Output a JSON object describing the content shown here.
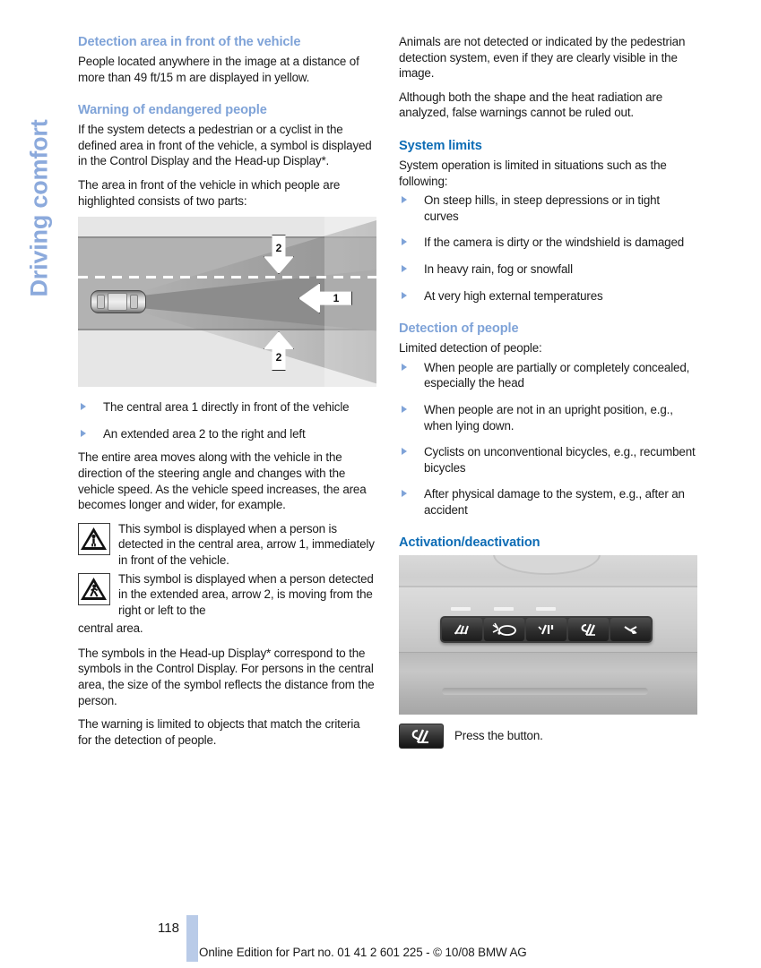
{
  "sidebar": {
    "chapter_label": "Driving comfort"
  },
  "left_column": {
    "heading_detection_area": "Detection area in front of the vehicle",
    "para_detection_area": "People located anywhere in the image at a distance of more than 49 ft/15 m are displayed in yellow.",
    "heading_warning": "Warning of endangered people",
    "para_warning_1": "If the system detects a pedestrian or a cyclist in the defined area in front of the vehicle, a symbol is displayed in the Control Display and the Head-up Display*.",
    "para_warning_2": "The area in front of the vehicle in which people are highlighted consists of two parts:",
    "figure_road": {
      "name": "detection-area-diagram",
      "callout_central": "1",
      "callout_extended_top": "2",
      "callout_extended_bottom": "2"
    },
    "area_bullets": [
      "The central area 1 directly in front of the vehicle",
      "An extended area 2 to the right and left"
    ],
    "para_area_moves": "The entire area moves along with the vehicle in the direction of the steering angle and changes with the vehicle speed. As the vehicle speed increases, the area becomes longer and wider, for example.",
    "symbol_rows": [
      {
        "icon": "pedestrian-warning-central-icon",
        "text": "This symbol is displayed when a person is detected in the central area, arrow 1, immediately in front of the vehicle."
      },
      {
        "icon": "pedestrian-warning-extended-icon",
        "text": "This symbol is displayed when a person detected in the extended area, arrow 2, is moving from the right or left to the"
      }
    ],
    "symbol_row2_continuation": "central area.",
    "para_headup": "The symbols in the Head-up Display* correspond to the symbols in the Control Display. For persons in the central area, the size of the symbol reflects the distance from the person.",
    "para_warning_limited": "The warning is limited to objects that match the criteria for the detection of people."
  },
  "right_column": {
    "para_animals": "Animals are not detected or indicated by the pedestrian detection system, even if they are clearly visible in the image.",
    "para_shape_heat": "Although both the shape and the heat radiation are analyzed, false warnings cannot be ruled out.",
    "heading_system_limits": "System limits",
    "para_system_limits": "System operation is limited in situations such as the following:",
    "system_limit_bullets": [
      "On steep hills, in steep depressions or in tight curves",
      "If the camera is dirty or the windshield is damaged",
      "In heavy rain, fog or snowfall",
      "At very high external temperatures"
    ],
    "heading_detection_people": "Detection of people",
    "para_detection_people": "Limited detection of people:",
    "detection_people_bullets": [
      "When people are partially or completely concealed, especially the head",
      "When people are not in an upright position, e.g., when lying down.",
      "Cyclists on unconventional bicycles, e.g., recumbent bicycles",
      "After physical damage to the system, e.g., after an accident"
    ],
    "heading_activation": "Activation/deactivation",
    "figure_console": {
      "name": "overhead-console-photo",
      "buttons": [
        "sos-emergency-button-icon",
        "convertible-top-button-icon",
        "interior-light-button-icon",
        "night-vision-button-icon",
        "rear-light-button-icon"
      ]
    },
    "press_button_icon": "night-vision-button-icon",
    "press_button_text": "Press the button."
  },
  "footer": {
    "page_number": "118",
    "edition_text": "Online Edition for Part no. 01 41 2 601 225 - © 10/08 BMW AG"
  },
  "colors": {
    "heading_light_blue": "#7fa3d8",
    "heading_deep_blue": "#0d6cb5",
    "sidebar_blue": "#8caadc",
    "page_bar_blue": "#b9cbe8",
    "body_text": "#1a1a1a"
  }
}
